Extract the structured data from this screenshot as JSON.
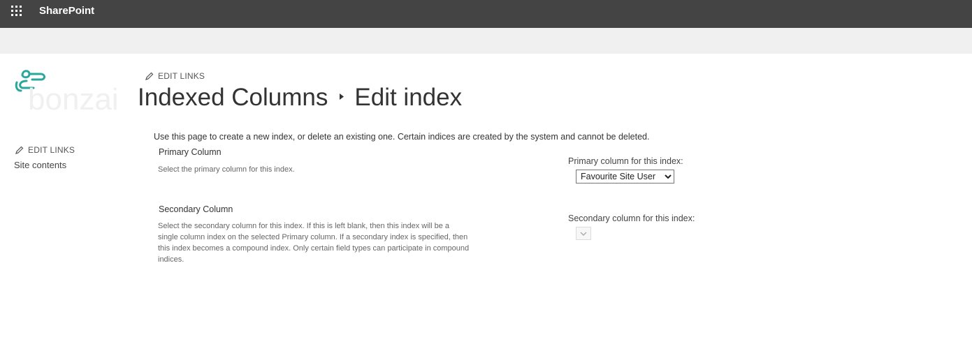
{
  "suitebar": {
    "app_name": "SharePoint",
    "bg_color": "#444444"
  },
  "logo": {
    "text": "bonzai",
    "accent_color": "#2aa79b"
  },
  "edit_links_label": "EDIT LINKS",
  "nav": {
    "site_contents": "Site contents"
  },
  "title": {
    "parent": "Indexed Columns",
    "separator_icon": "breadcrumb-arrow-icon",
    "current": "Edit index"
  },
  "intro": "Use this page to create a new index, or delete an existing one. Certain indices are created by the system and cannot be deleted.",
  "primary": {
    "title": "Primary Column",
    "description": "Select the primary column for this index.",
    "label": "Primary column for this index:",
    "selected": "Favourite Site User"
  },
  "secondary": {
    "title": "Secondary Column",
    "description_lines": [
      "Select the secondary column for this index. If this is left blank, then this index will be a",
      "single column index on the selected Primary column. If a secondary index is specified, then",
      "this index becomes a compound index. Only certain field types can participate in compound",
      "indices."
    ],
    "label": "Secondary column for this index:",
    "selected": ""
  }
}
